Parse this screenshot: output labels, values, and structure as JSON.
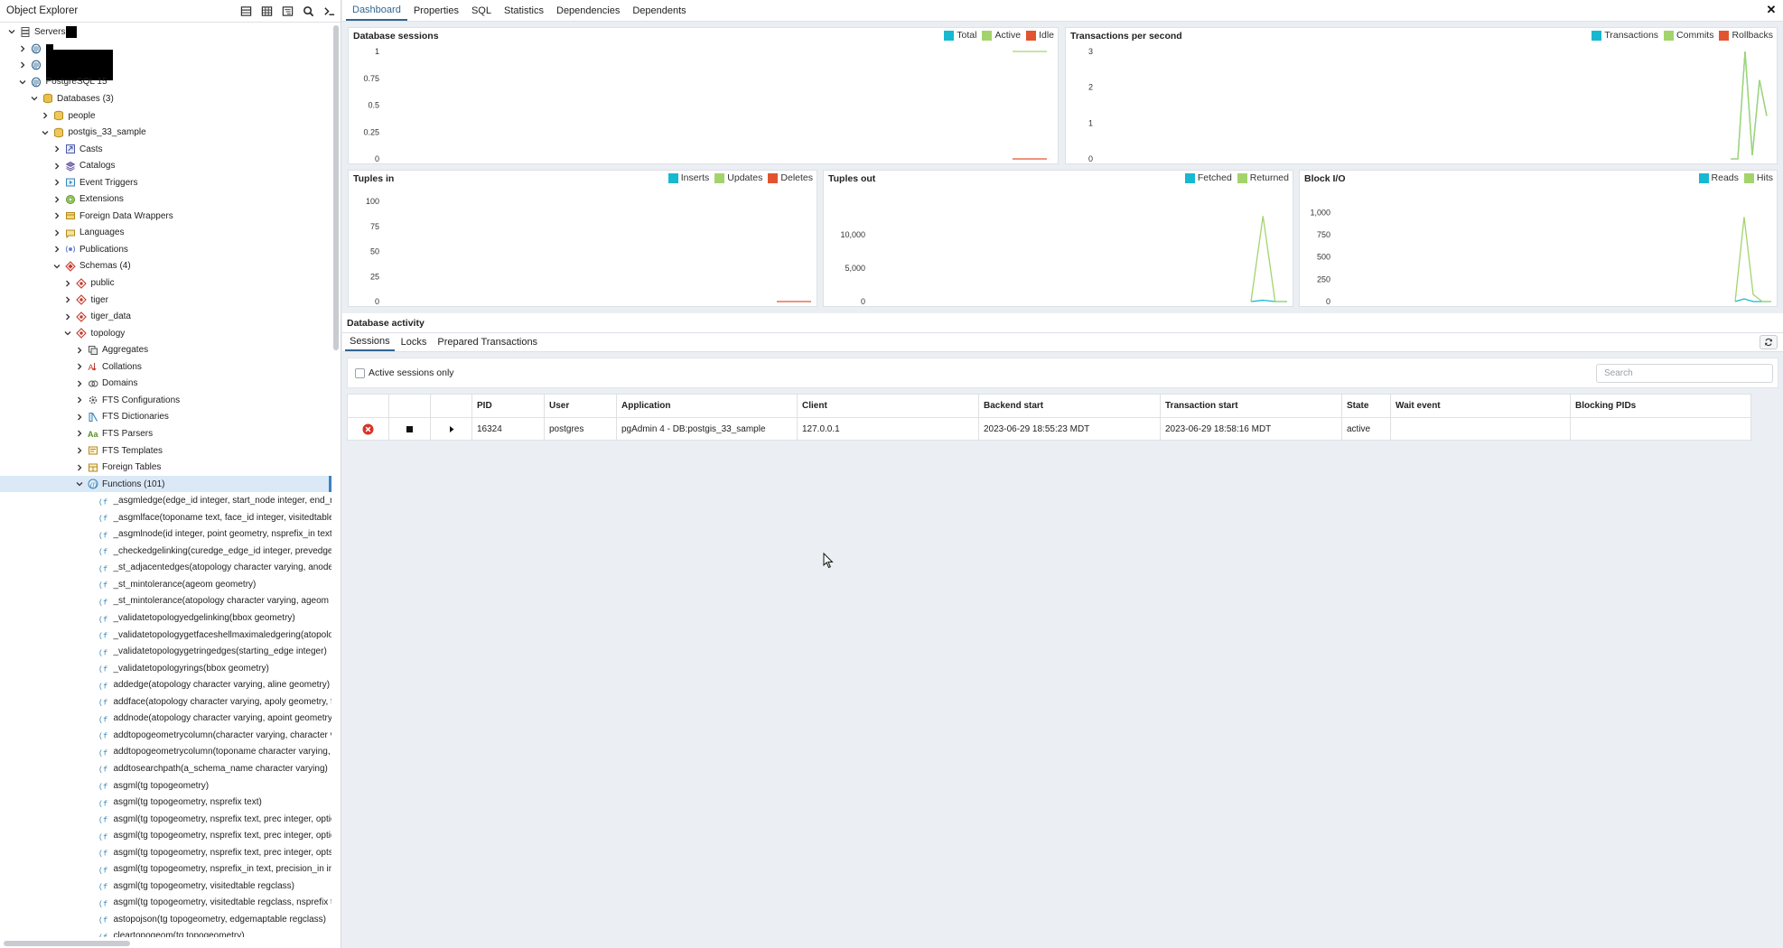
{
  "explorer": {
    "title": "Object Explorer",
    "toolbar": [
      "table-icon",
      "grid-icon",
      "filter-tree-icon",
      "search-icon",
      "terminal-icon"
    ],
    "tree": [
      {
        "label": "Servers",
        "depth": 0,
        "toggle": "down",
        "icon": "servers-icon",
        "redact": [
          12,
          13
        ]
      },
      {
        "label": "",
        "depth": 1,
        "toggle": "right",
        "icon": "server-icon",
        "redact": [
          8,
          10
        ]
      },
      {
        "label": "",
        "depth": 1,
        "toggle": "right",
        "icon": "server-icon",
        "redact": [
          74,
          34
        ]
      },
      {
        "label": "PostgreSQL 15",
        "depth": 1,
        "toggle": "down",
        "icon": "server-icon"
      },
      {
        "label": "Databases (3)",
        "depth": 2,
        "toggle": "down",
        "icon": "databases-icon"
      },
      {
        "label": "people",
        "depth": 3,
        "toggle": "right",
        "icon": "database-icon"
      },
      {
        "label": "postgis_33_sample",
        "depth": 3,
        "toggle": "down",
        "icon": "database-icon"
      },
      {
        "label": "Casts",
        "depth": 4,
        "toggle": "right",
        "icon": "casts-icon"
      },
      {
        "label": "Catalogs",
        "depth": 4,
        "toggle": "right",
        "icon": "catalogs-icon"
      },
      {
        "label": "Event Triggers",
        "depth": 4,
        "toggle": "right",
        "icon": "event-trigger-icon"
      },
      {
        "label": "Extensions",
        "depth": 4,
        "toggle": "right",
        "icon": "extension-icon"
      },
      {
        "label": "Foreign Data Wrappers",
        "depth": 4,
        "toggle": "right",
        "icon": "fdw-icon"
      },
      {
        "label": "Languages",
        "depth": 4,
        "toggle": "right",
        "icon": "language-icon"
      },
      {
        "label": "Publications",
        "depth": 4,
        "toggle": "right",
        "icon": "publication-icon"
      },
      {
        "label": "Schemas (4)",
        "depth": 4,
        "toggle": "down",
        "icon": "schemas-icon"
      },
      {
        "label": "public",
        "depth": 5,
        "toggle": "right",
        "icon": "schema-icon"
      },
      {
        "label": "tiger",
        "depth": 5,
        "toggle": "right",
        "icon": "schema-icon"
      },
      {
        "label": "tiger_data",
        "depth": 5,
        "toggle": "right",
        "icon": "schema-icon"
      },
      {
        "label": "topology",
        "depth": 5,
        "toggle": "down",
        "icon": "schema-icon"
      },
      {
        "label": "Aggregates",
        "depth": 6,
        "toggle": "right",
        "icon": "aggregate-icon"
      },
      {
        "label": "Collations",
        "depth": 6,
        "toggle": "right",
        "icon": "collation-icon"
      },
      {
        "label": "Domains",
        "depth": 6,
        "toggle": "right",
        "icon": "domain-icon"
      },
      {
        "label": "FTS Configurations",
        "depth": 6,
        "toggle": "right",
        "icon": "fts-config-icon"
      },
      {
        "label": "FTS Dictionaries",
        "depth": 6,
        "toggle": "right",
        "icon": "fts-dictionary-icon"
      },
      {
        "label": "FTS Parsers",
        "depth": 6,
        "toggle": "right",
        "icon": "fts-parser-icon"
      },
      {
        "label": "FTS Templates",
        "depth": 6,
        "toggle": "right",
        "icon": "fts-template-icon"
      },
      {
        "label": "Foreign Tables",
        "depth": 6,
        "toggle": "right",
        "icon": "foreign-table-icon"
      },
      {
        "label": "Functions (101)",
        "depth": 6,
        "toggle": "down",
        "icon": "functions-icon",
        "selected": true
      },
      {
        "label": "_asgmledge(edge_id integer, start_node integer, end_node",
        "depth": 7,
        "icon": "function-icon"
      },
      {
        "label": "_asgmlface(toponame text, face_id integer, visitedtable r",
        "depth": 7,
        "icon": "function-icon"
      },
      {
        "label": "_asgmlnode(id integer, point geometry, nsprefix_in text, p",
        "depth": 7,
        "icon": "function-icon"
      },
      {
        "label": "_checkedgelinking(curedge_edge_id integer, prevedge_ed",
        "depth": 7,
        "icon": "function-icon"
      },
      {
        "label": "_st_adjacentedges(atopology character varying, anode in",
        "depth": 7,
        "icon": "function-icon"
      },
      {
        "label": "_st_mintolerance(ageom geometry)",
        "depth": 7,
        "icon": "function-icon"
      },
      {
        "label": "_st_mintolerance(atopology character varying, ageom ge",
        "depth": 7,
        "icon": "function-icon"
      },
      {
        "label": "_validatetopologyedgelinking(bbox geometry)",
        "depth": 7,
        "icon": "function-icon"
      },
      {
        "label": "_validatetopologygetfaceshellmaximaledgering(atopolog",
        "depth": 7,
        "icon": "function-icon"
      },
      {
        "label": "_validatetopologygetringedges(starting_edge integer)",
        "depth": 7,
        "icon": "function-icon"
      },
      {
        "label": "_validatetopologyrings(bbox geometry)",
        "depth": 7,
        "icon": "function-icon"
      },
      {
        "label": "addedge(atopology character varying, aline geometry)",
        "depth": 7,
        "icon": "function-icon"
      },
      {
        "label": "addface(atopology character varying, apoly geometry, for",
        "depth": 7,
        "icon": "function-icon"
      },
      {
        "label": "addnode(atopology character varying, apoint geometry, a",
        "depth": 7,
        "icon": "function-icon"
      },
      {
        "label": "addtopogeometrycolumn(character varying, character va",
        "depth": 7,
        "icon": "function-icon"
      },
      {
        "label": "addtopogeometrycolumn(toponame character varying, sc",
        "depth": 7,
        "icon": "function-icon"
      },
      {
        "label": "addtosearchpath(a_schema_name character varying)",
        "depth": 7,
        "icon": "function-icon"
      },
      {
        "label": "asgml(tg topogeometry)",
        "depth": 7,
        "icon": "function-icon"
      },
      {
        "label": "asgml(tg topogeometry, nsprefix text)",
        "depth": 7,
        "icon": "function-icon"
      },
      {
        "label": "asgml(tg topogeometry, nsprefix text, prec integer, option",
        "depth": 7,
        "icon": "function-icon"
      },
      {
        "label": "asgml(tg topogeometry, nsprefix text, prec integer, option",
        "depth": 7,
        "icon": "function-icon"
      },
      {
        "label": "asgml(tg topogeometry, nsprefix text, prec integer, opts i",
        "depth": 7,
        "icon": "function-icon"
      },
      {
        "label": "asgml(tg topogeometry, nsprefix_in text, precision_in inte",
        "depth": 7,
        "icon": "function-icon"
      },
      {
        "label": "asgml(tg topogeometry, visitedtable regclass)",
        "depth": 7,
        "icon": "function-icon"
      },
      {
        "label": "asgml(tg topogeometry, visitedtable regclass, nsprefix te",
        "depth": 7,
        "icon": "function-icon"
      },
      {
        "label": "astopojson(tg topogeometry, edgemaptable regclass)",
        "depth": 7,
        "icon": "function-icon"
      },
      {
        "label": "cleartopogeom(tg topogeometry)",
        "depth": 7,
        "icon": "function-icon"
      }
    ]
  },
  "tabs": [
    {
      "label": "Dashboard",
      "active": true
    },
    {
      "label": "Properties"
    },
    {
      "label": "SQL"
    },
    {
      "label": "Statistics"
    },
    {
      "label": "Dependencies"
    },
    {
      "label": "Dependents"
    }
  ],
  "colors": {
    "cyan": "#17b9d0",
    "green": "#a3d46c",
    "red": "#e2542f",
    "accent": "#326690",
    "danger": "#d9342b"
  },
  "chart_data": [
    {
      "type": "line",
      "title": "Database sessions",
      "ylim": [
        0,
        1
      ],
      "yticks": [
        "1",
        "0.75",
        "0.5",
        "0.25",
        "0"
      ],
      "ytick_values": [
        1,
        0.75,
        0.5,
        0.25,
        0
      ],
      "x": [
        0,
        1,
        2,
        3
      ],
      "series": [
        {
          "name": "Total",
          "color": "#17b9d0",
          "values": [
            null,
            null,
            null,
            null
          ]
        },
        {
          "name": "Active",
          "color": "#a3d46c",
          "values": [
            null,
            null,
            1,
            1
          ]
        },
        {
          "name": "Idle",
          "color": "#e2542f",
          "values": [
            null,
            null,
            0,
            0
          ]
        }
      ]
    },
    {
      "type": "line",
      "title": "Transactions per second",
      "ylim": [
        0,
        3
      ],
      "yticks": [
        "3",
        "2",
        "1",
        "0"
      ],
      "ytick_values": [
        3,
        2,
        1,
        0
      ],
      "x": [
        0,
        1,
        2,
        3,
        4,
        5,
        6,
        7
      ],
      "series": [
        {
          "name": "Transactions",
          "color": "#17b9d0",
          "values": [
            null,
            null,
            0,
            0,
            3,
            0.1,
            2.2,
            1.2
          ]
        },
        {
          "name": "Commits",
          "color": "#a3d46c",
          "values": [
            null,
            null,
            0,
            0,
            3,
            0.1,
            2.2,
            1.2
          ]
        },
        {
          "name": "Rollbacks",
          "color": "#e2542f",
          "values": [
            null,
            null,
            null,
            null,
            null,
            null,
            null,
            null
          ]
        }
      ]
    },
    {
      "type": "line",
      "title": "Tuples in",
      "ylim": [
        0,
        100
      ],
      "yticks": [
        "100",
        "75",
        "50",
        "25",
        "0"
      ],
      "ytick_values": [
        100,
        75,
        50,
        25,
        0
      ],
      "x": [
        0,
        1,
        2,
        3
      ],
      "series": [
        {
          "name": "Inserts",
          "color": "#17b9d0",
          "values": [
            null,
            null,
            null,
            null
          ]
        },
        {
          "name": "Updates",
          "color": "#a3d46c",
          "values": [
            null,
            null,
            null,
            null
          ]
        },
        {
          "name": "Deletes",
          "color": "#e2542f",
          "values": [
            null,
            null,
            0,
            0
          ]
        }
      ]
    },
    {
      "type": "line",
      "title": "Tuples out",
      "ylim": [
        0,
        15000
      ],
      "yticks": [
        "10,000",
        "5,000",
        "0"
      ],
      "ytick_values": [
        10000,
        5000,
        0
      ],
      "x": [
        0,
        1,
        2,
        3,
        4,
        5
      ],
      "series": [
        {
          "name": "Fetched",
          "color": "#17b9d0",
          "values": [
            null,
            null,
            0,
            200,
            0,
            0
          ]
        },
        {
          "name": "Returned",
          "color": "#a3d46c",
          "values": [
            null,
            null,
            0,
            12800,
            0,
            0
          ]
        }
      ]
    },
    {
      "type": "line",
      "title": "Block I/O",
      "ylim": [
        0,
        1125
      ],
      "yticks": [
        "1,000",
        "750",
        "500",
        "250",
        "0"
      ],
      "ytick_values": [
        1000,
        750,
        500,
        250,
        0
      ],
      "x": [
        0,
        1,
        2,
        3,
        4,
        5,
        6
      ],
      "series": [
        {
          "name": "Reads",
          "color": "#17b9d0",
          "values": [
            null,
            null,
            0,
            30,
            0,
            0,
            0
          ]
        },
        {
          "name": "Hits",
          "color": "#a3d46c",
          "values": [
            null,
            null,
            0,
            950,
            80,
            0,
            0
          ]
        }
      ]
    }
  ],
  "activity": {
    "title": "Database activity",
    "subtabs": [
      {
        "label": "Sessions",
        "active": true
      },
      {
        "label": "Locks"
      },
      {
        "label": "Prepared Transactions"
      }
    ],
    "active_only_label": "Active sessions only",
    "search_placeholder": "Search",
    "columns": [
      "",
      "",
      "",
      "PID",
      "User",
      "Application",
      "Client",
      "Backend start",
      "Transaction start",
      "State",
      "Wait event",
      "Blocking PIDs"
    ],
    "rows": [
      {
        "pid": "16324",
        "user": "postgres",
        "application": "pgAdmin 4 - DB:postgis_33_sample",
        "client": "127.0.0.1",
        "backend_start": "2023-06-29 18:55:23 MDT",
        "transaction_start": "2023-06-29 18:58:16 MDT",
        "state": "active",
        "wait_event": "",
        "blocking_pids": ""
      }
    ]
  }
}
